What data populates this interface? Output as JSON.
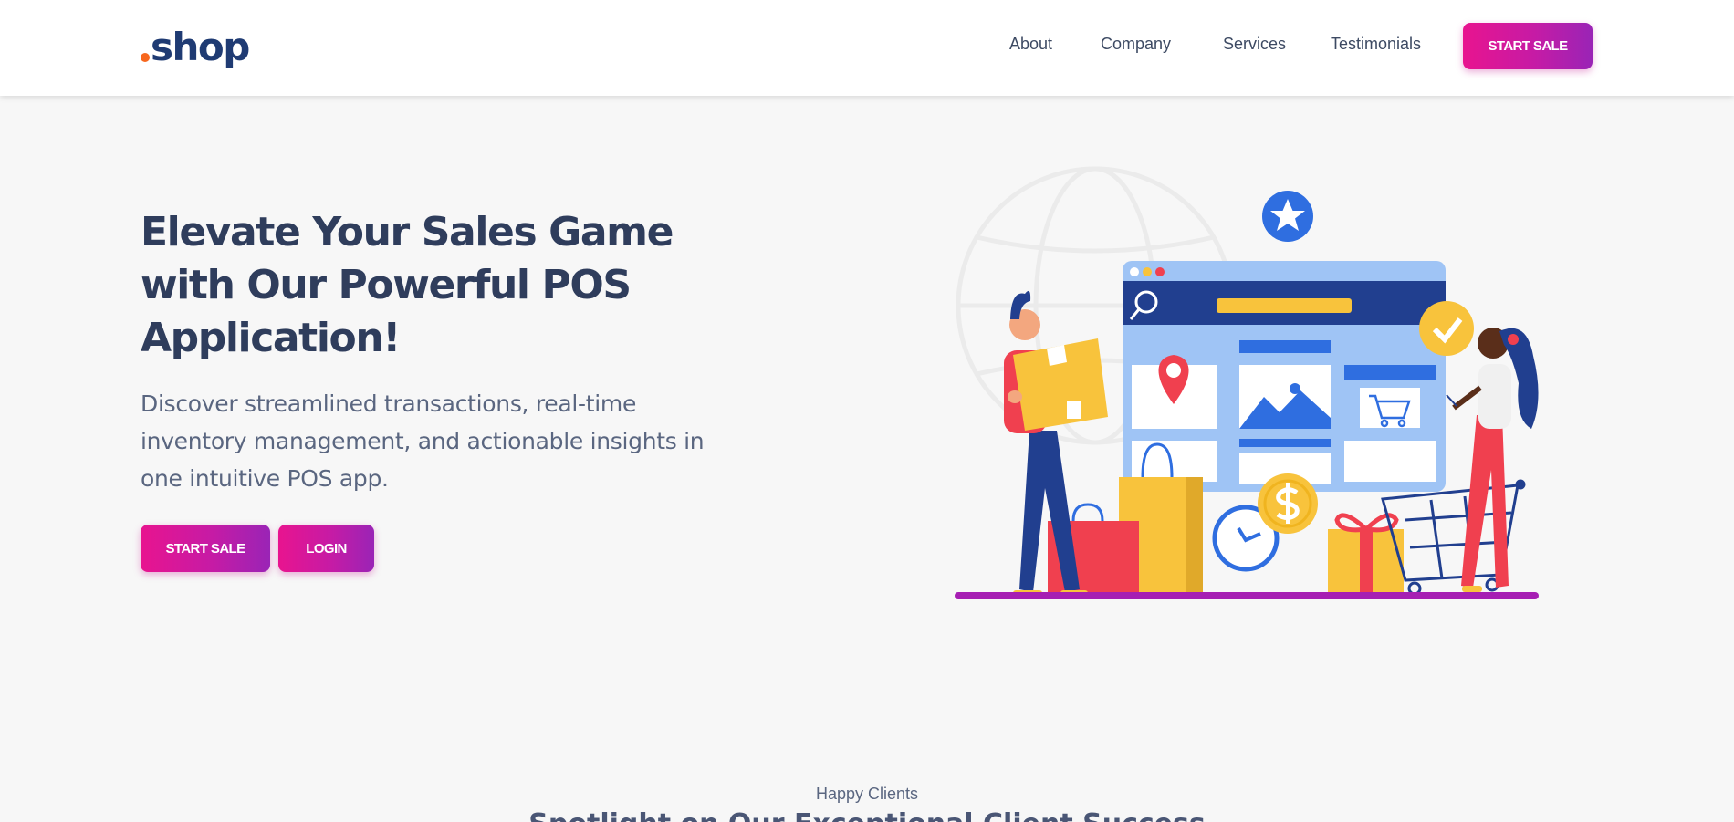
{
  "brand": {
    "dot_color": "#f7671e",
    "name": "shop"
  },
  "nav": {
    "links": [
      "About",
      "Company",
      "Services",
      "Testimonials"
    ],
    "cta_label": "START SALE"
  },
  "hero": {
    "title": "Elevate Your Sales Game with Our Powerful POS Application!",
    "subtitle": "Discover streamlined transactions, real-time inventory management, and actionable insights in one intuitive POS app.",
    "primary_button": "START SALE",
    "secondary_button": "LOGIN"
  },
  "section": {
    "eyebrow": "Happy Clients",
    "title": "Spotlight on Our Exceptional Client Success"
  },
  "colors": {
    "accent_gradient_start": "#e8148f",
    "accent_gradient_end": "#9a24b6",
    "heading": "#2f3d5c",
    "brand_blue": "#1f3b73"
  }
}
